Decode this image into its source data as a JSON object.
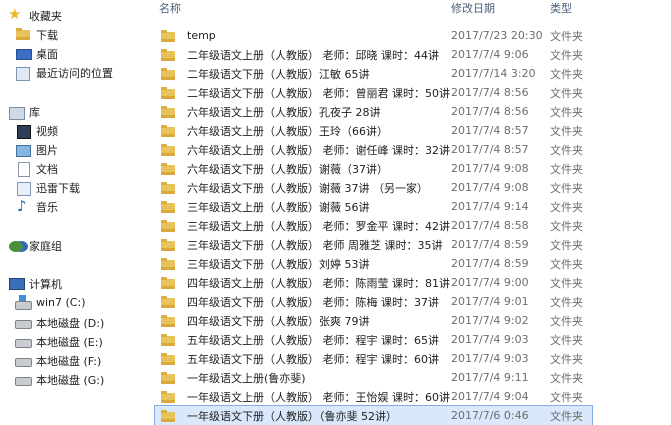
{
  "nav": {
    "favorites": "收藏夹",
    "downloads": "下载",
    "desktop": "桌面",
    "recent": "最近访问的位置",
    "libraries": "库",
    "videos": "视频",
    "pictures": "图片",
    "documents": "文档",
    "xunlei": "迅雷下载",
    "music": "音乐",
    "homegroup": "家庭组",
    "computer": "计算机",
    "drive_c": "win7 (C:)",
    "drive_d": "本地磁盘 (D:)",
    "drive_e": "本地磁盘 (E:)",
    "drive_f": "本地磁盘 (F:)",
    "drive_g": "本地磁盘 (G:)"
  },
  "columns": {
    "name": "名称",
    "date": "修改日期",
    "type": "类型"
  },
  "files": [
    {
      "name": "temp",
      "date": "2017/7/23 20:30",
      "type": "文件夹"
    },
    {
      "name": "二年级语文上册（人教版） 老师：邱晓 课时：44讲",
      "date": "2017/7/4 9:06",
      "type": "文件夹"
    },
    {
      "name": "二年级语文下册（人教版）江敏 65讲",
      "date": "2017/7/14 3:20",
      "type": "文件夹"
    },
    {
      "name": "二年级语文下册（人教版） 老师：曾丽君 课时：50讲",
      "date": "2017/7/4 8:56",
      "type": "文件夹"
    },
    {
      "name": "六年级语文上册（人教版）孔夜子 28讲",
      "date": "2017/7/4 8:56",
      "type": "文件夹"
    },
    {
      "name": "六年级语文上册（人教版）王玲（66讲）",
      "date": "2017/7/4 8:57",
      "type": "文件夹"
    },
    {
      "name": "六年级语文上册（人教版） 老师：谢任峰 课时：32讲",
      "date": "2017/7/4 8:57",
      "type": "文件夹"
    },
    {
      "name": "六年级语文下册（人教版）谢薇（37讲）",
      "date": "2017/7/4 9:08",
      "type": "文件夹"
    },
    {
      "name": "六年级语文下册（人教版）谢薇 37讲 （另一家）",
      "date": "2017/7/4 9:08",
      "type": "文件夹"
    },
    {
      "name": "三年级语文上册（人教版）谢薇 56讲",
      "date": "2017/7/4 9:14",
      "type": "文件夹"
    },
    {
      "name": "三年级语文上册（人教版） 老师：罗金平 课时：42讲",
      "date": "2017/7/4 8:58",
      "type": "文件夹"
    },
    {
      "name": "三年级语文下册（人教版） 老师 周雅芝 课时：35讲",
      "date": "2017/7/4 8:59",
      "type": "文件夹"
    },
    {
      "name": "三年级语文下册（人教版）刘婷 53讲",
      "date": "2017/7/4 8:59",
      "type": "文件夹"
    },
    {
      "name": "四年级语文上册（人教版） 老师：陈雨莹 课时：81讲",
      "date": "2017/7/4 9:00",
      "type": "文件夹"
    },
    {
      "name": "四年级语文下册（人教版） 老师：陈梅 课时：37讲",
      "date": "2017/7/4 9:01",
      "type": "文件夹"
    },
    {
      "name": "四年级语文下册（人教版）张爽 79讲",
      "date": "2017/7/4 9:02",
      "type": "文件夹"
    },
    {
      "name": "五年级语文上册（人教版） 老师：程宇 课时：65讲",
      "date": "2017/7/4 9:03",
      "type": "文件夹"
    },
    {
      "name": "五年级语文下册（人教版） 老师：程宇 课时：60讲",
      "date": "2017/7/4 9:03",
      "type": "文件夹"
    },
    {
      "name": "一年级语文上册(鲁亦斐)",
      "date": "2017/7/4 9:11",
      "type": "文件夹"
    },
    {
      "name": "一年级语文上册（人教版） 老师：王怡娱 课时：60讲",
      "date": "2017/7/4 9:04",
      "type": "文件夹"
    },
    {
      "name": "一年级语文下册（人教版）（鲁亦斐 52讲）",
      "date": "2017/7/6 0:46",
      "type": "文件夹"
    }
  ]
}
